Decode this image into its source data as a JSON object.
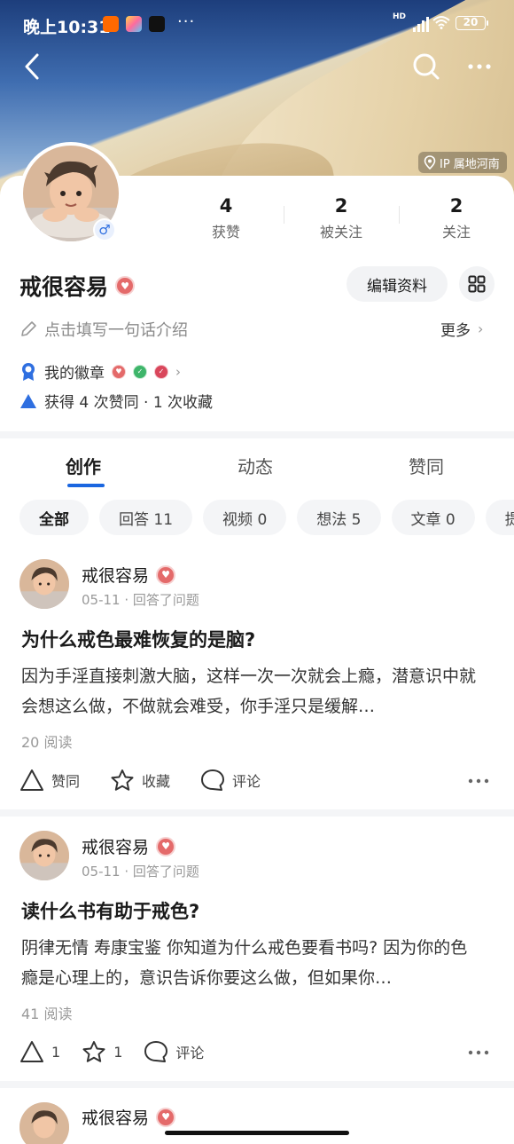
{
  "status_bar": {
    "time": "晚上10:31",
    "app_icons": [
      "mi-icon",
      "multiapp-icon",
      "tiktok-icon"
    ],
    "more": "···",
    "hd": "HD",
    "battery": "20"
  },
  "header": {
    "ip_location": "IP 属地河南"
  },
  "profile": {
    "name": "戒很容易",
    "gender": "♂",
    "stats": [
      {
        "value": "4",
        "label": "获赞"
      },
      {
        "value": "2",
        "label": "被关注"
      },
      {
        "value": "2",
        "label": "关注"
      }
    ],
    "edit_label": "编辑资料",
    "bio_placeholder": "点击填写一句话介绍",
    "more_label": "更多",
    "badges_label": "我的徽章",
    "achievement": "获得 4 次赞同 · 1 次收藏"
  },
  "tabs": [
    {
      "label": "创作",
      "active": true
    },
    {
      "label": "动态",
      "active": false
    },
    {
      "label": "赞同",
      "active": false
    }
  ],
  "filters": [
    {
      "label": "全部",
      "active": true
    },
    {
      "label": "回答 11"
    },
    {
      "label": "视频 0"
    },
    {
      "label": "想法 5"
    },
    {
      "label": "文章 0"
    },
    {
      "label": "提"
    }
  ],
  "posts": [
    {
      "author": "戒很容易",
      "meta": "05-11 · 回答了问题",
      "title": "为什么戒色最难恢复的是脑?",
      "excerpt": "因为手淫直接刺激大脑，这样一次一次就会上瘾，潜意识中就会想这么做，不做就会难受，你手淫只是缓解…",
      "reads": "20 阅读",
      "like": "赞同",
      "fav": "收藏",
      "comment": "评论"
    },
    {
      "author": "戒很容易",
      "meta": "05-11 · 回答了问题",
      "title": "读什么书有助于戒色?",
      "excerpt": "阴律无情 寿康宝鉴 你知道为什么戒色要看书吗? 因为你的色瘾是心理上的，意识告诉你要这么做，但如果你…",
      "reads": "41 阅读",
      "like": "1",
      "fav": "1",
      "comment": "评论"
    },
    {
      "author": "戒很容易"
    }
  ],
  "colors": {
    "accent": "#1a66e0",
    "medal": "#e46a6a",
    "chip_bg": "#f4f5f7"
  }
}
